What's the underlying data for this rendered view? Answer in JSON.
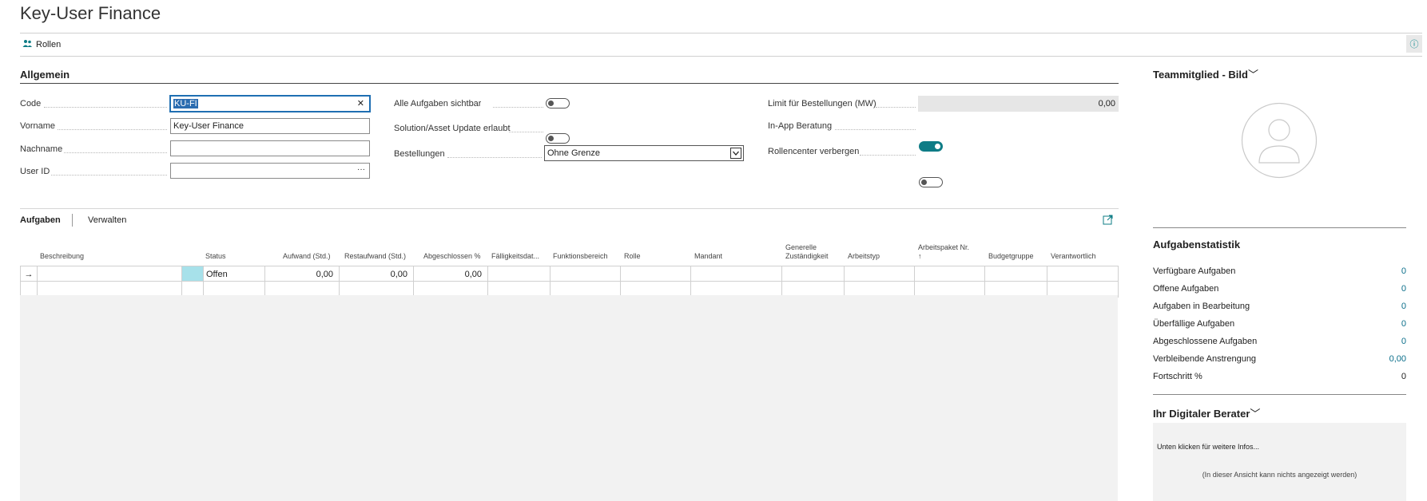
{
  "page": {
    "title": "Key-User Finance"
  },
  "actionbar": {
    "rollen_label": "Rollen",
    "info_icon": "info-icon",
    "info_glyph": "ⓘ"
  },
  "allgemein": {
    "title": "Allgemein",
    "code": {
      "label": "Code",
      "value": "KU-FI"
    },
    "vorname": {
      "label": "Vorname",
      "value": "Key-User Finance"
    },
    "nachname": {
      "label": "Nachname",
      "value": ""
    },
    "user_id": {
      "label": "User ID",
      "value": "",
      "lookup": "···"
    },
    "alle_aufgaben": {
      "label": "Alle Aufgaben sichtbar",
      "on": false
    },
    "solution_update": {
      "label": "Solution/Asset Update erlaubt",
      "on": false
    },
    "bestellungen": {
      "label": "Bestellungen",
      "value": "Ohne Grenze"
    },
    "limit": {
      "label": "Limit für Bestellungen (MW)",
      "value": "0,00"
    },
    "inapp": {
      "label": "In-App Beratung",
      "on": true
    },
    "rollencenter": {
      "label": "Rollencenter verbergen",
      "on": false
    },
    "clear_glyph": "✕"
  },
  "aufgaben": {
    "tabs": [
      "Aufgaben",
      "Verwalten"
    ],
    "columns": {
      "beschreibung": "Beschreibung",
      "status": "Status",
      "aufwand": "Aufwand (Std.)",
      "restaufwand": "Restaufwand (Std.)",
      "abgeschlossen": "Abgeschlossen %",
      "faelligkeit": "Fälligkeitsdat...",
      "funktionsbereich": "Funktionsbereich",
      "rolle": "Rolle",
      "mandant": "Mandant",
      "generelle_1": "Generelle",
      "generelle_2": "Zuständigkeit",
      "arbeitstyp": "Arbeitstyp",
      "arbeitspaket_1": "Arbeitspaket Nr.",
      "arbeitspaket_2": "↑",
      "budgetgruppe": "Budgetgruppe",
      "verantwortlich": "Verantwortlich"
    },
    "rows": [
      {
        "marker": "→",
        "beschreibung": "",
        "status": "Offen",
        "aufwand": "0,00",
        "restaufwand": "0,00",
        "abgeschlossen": "0,00"
      }
    ]
  },
  "teammitglied": {
    "title": "Teammitglied - Bild",
    "chevron": "﹀"
  },
  "statistik": {
    "title": "Aufgabenstatistik",
    "items": [
      {
        "label": "Verfügbare Aufgaben",
        "value": "0"
      },
      {
        "label": "Offene Aufgaben",
        "value": "0"
      },
      {
        "label": "Aufgaben in Bearbeitung",
        "value": "0"
      },
      {
        "label": "Überfällige Aufgaben",
        "value": "0"
      },
      {
        "label": "Abgeschlossene Aufgaben",
        "value": "0"
      },
      {
        "label": "Verbleibende Anstrengung",
        "value": "0,00"
      },
      {
        "label": "Fortschritt %",
        "value": "0"
      }
    ]
  },
  "berater": {
    "title": "Ihr Digitaler Berater",
    "chevron": "﹀",
    "hint": "Unten klicken für weitere Infos...",
    "empty": "(In dieser Ansicht kann nichts angezeigt werden)"
  }
}
